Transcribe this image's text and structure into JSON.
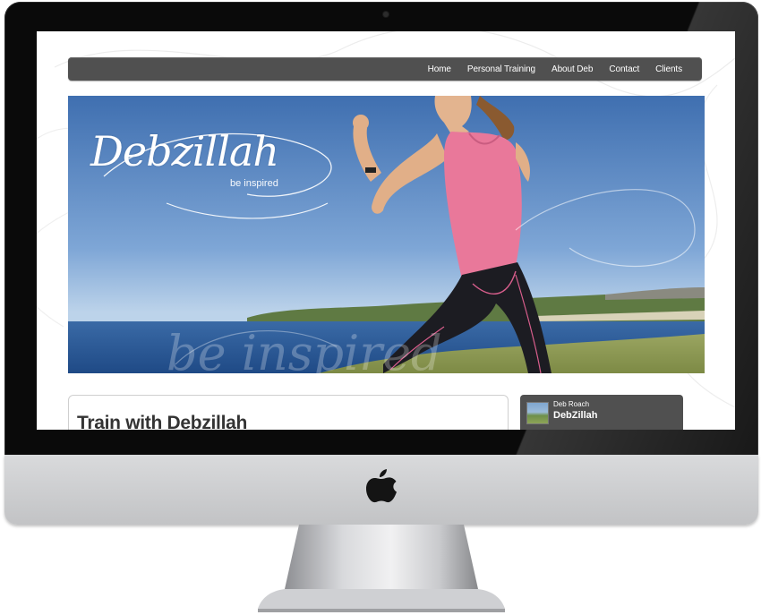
{
  "nav": {
    "items": [
      {
        "label": "Home"
      },
      {
        "label": "Personal Training"
      },
      {
        "label": "About Deb"
      },
      {
        "label": "Contact"
      },
      {
        "label": "Clients"
      }
    ]
  },
  "hero": {
    "logo_text": "Debzillah",
    "tagline": "be inspired",
    "watermark": "be inspired"
  },
  "content": {
    "title": "Train with Debzillah"
  },
  "profile": {
    "name": "Deb Roach",
    "handle": "DebZillah"
  },
  "colors": {
    "navbar": "#505050",
    "sky": "#6a94c8",
    "sea": "#2f5e9a",
    "top": "#e9789a",
    "grass": "#8d9a55"
  },
  "icons": {
    "brand": "apple-logo-icon"
  }
}
